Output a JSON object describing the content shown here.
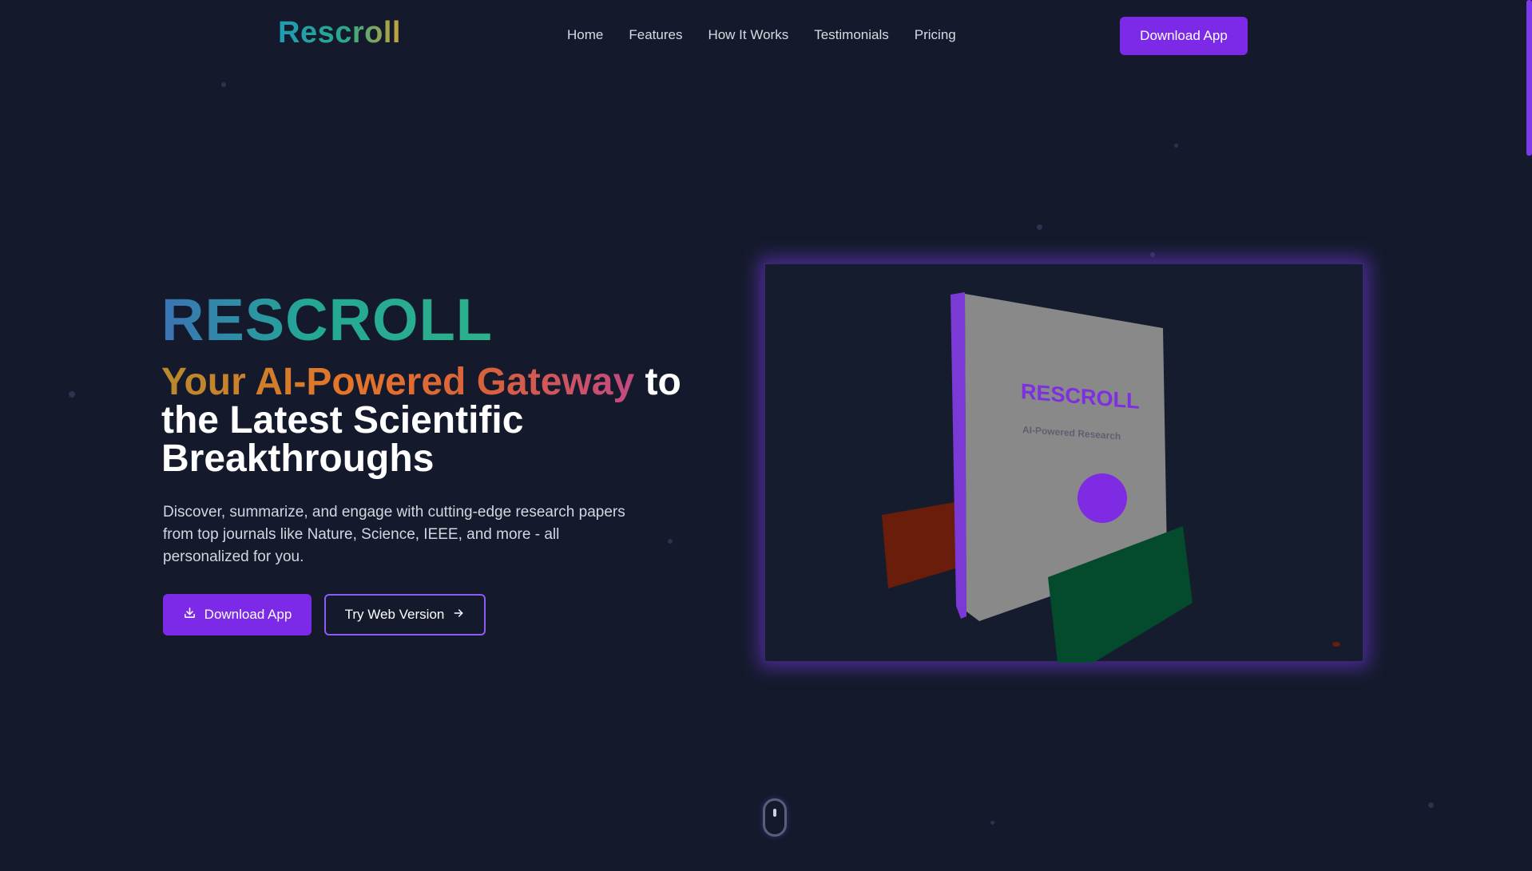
{
  "nav": {
    "logo": "Rescroll",
    "links": [
      "Home",
      "Features",
      "How It Works",
      "Testimonials",
      "Pricing"
    ],
    "cta": "Download App"
  },
  "hero": {
    "title": "RESCROLL",
    "subtitle_highlight": "Your AI-Powered Gateway",
    "subtitle_rest": " to the Latest Scientific Breakthroughs",
    "description": "Discover, summarize, and engage with cutting-edge research papers from top journals like Nature, Science, IEEE, and more - all personalized for you.",
    "primary_button": "Download App",
    "primary_button_icon": "download-icon",
    "secondary_button": "Try Web Version",
    "secondary_button_icon": "arrow-right-icon"
  },
  "visual": {
    "book_title": "RESCROLL",
    "book_subtitle": "AI-Powered Research"
  },
  "colors": {
    "background": "#141a2b",
    "accent": "#7c2ae8",
    "button_border": "#8b5cf6"
  }
}
